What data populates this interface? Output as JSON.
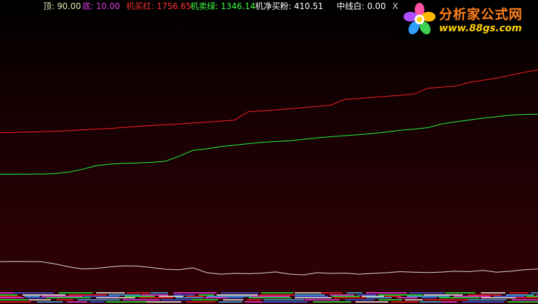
{
  "header": {
    "top_label": "顶: 90.00",
    "bottom_label": "底: 10.00",
    "buy_red_label": "机买红: 1756.65",
    "sell_green_label": "机卖绿: 1346.14",
    "net_label": "机净买粉: 410.51",
    "mid_label": "中线白: 0.00",
    "x_label": "X"
  },
  "logo": {
    "name": "分析家公式网",
    "url": "www.88gs.com"
  },
  "colors": {
    "red": "#ff2020",
    "green": "#20ff40",
    "white": "#dcdcdc",
    "pink": "#ff40ff",
    "logo_orange": "#ff7f1a",
    "logo_yellow": "#ffd000"
  },
  "chart_data": {
    "type": "line",
    "x": [
      1,
      2,
      3,
      4,
      5,
      6,
      7,
      8,
      9,
      10,
      11,
      12,
      13,
      14,
      15,
      16,
      17,
      18,
      19,
      20,
      21,
      22,
      23,
      24,
      25,
      26,
      27,
      28,
      29,
      30,
      31,
      32,
      33,
      34,
      35,
      36,
      37,
      38,
      39,
      40
    ],
    "ylim": [
      0,
      2000
    ],
    "series": [
      {
        "name": "机买红",
        "color": "#ff2020",
        "values": [
          1175,
          1177,
          1180,
          1182,
          1185,
          1190,
          1195,
          1200,
          1205,
          1212,
          1218,
          1225,
          1230,
          1236,
          1242,
          1248,
          1255,
          1262,
          1320,
          1325,
          1332,
          1340,
          1348,
          1356,
          1365,
          1405,
          1410,
          1418,
          1425,
          1432,
          1440,
          1480,
          1488,
          1495,
          1520,
          1535,
          1550,
          1570,
          1590,
          1606
        ]
      },
      {
        "name": "机卖绿",
        "color": "#20ff40",
        "values": [
          890,
          890,
          891,
          892,
          895,
          905,
          925,
          950,
          960,
          965,
          968,
          972,
          980,
          1015,
          1055,
          1065,
          1080,
          1090,
          1100,
          1110,
          1115,
          1120,
          1130,
          1140,
          1148,
          1155,
          1162,
          1170,
          1180,
          1192,
          1200,
          1210,
          1235,
          1250,
          1262,
          1275,
          1285,
          1296,
          1300,
          1302
        ]
      },
      {
        "name": "机净买粉",
        "color": "#dcdcdc",
        "values": [
          290,
          292,
          291,
          290,
          275,
          255,
          240,
          245,
          255,
          262,
          260,
          250,
          238,
          235,
          248,
          215,
          205,
          210,
          208,
          212,
          220,
          205,
          200,
          215,
          210,
          212,
          205,
          210,
          215,
          222,
          218,
          216,
          219,
          225,
          222,
          230,
          218,
          225,
          235,
          240
        ]
      }
    ],
    "bottom_band_colors": [
      "#ff40ff",
      "#4060ff",
      "#20ff40",
      "#ffffff",
      "#ff2020",
      "#40c0ff"
    ]
  }
}
